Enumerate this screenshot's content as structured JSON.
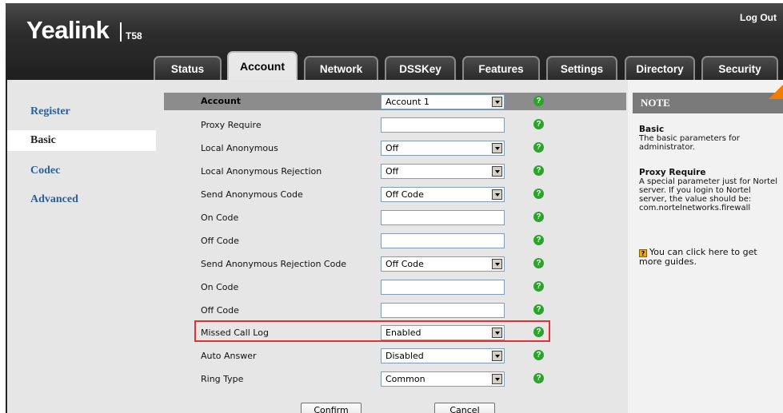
{
  "header": {
    "logo": "Yealink",
    "model": "T58",
    "logout": "Log Out"
  },
  "tabs": [
    {
      "label": "Status"
    },
    {
      "label": "Account",
      "active": true
    },
    {
      "label": "Network"
    },
    {
      "label": "DSSKey"
    },
    {
      "label": "Features"
    },
    {
      "label": "Settings"
    },
    {
      "label": "Directory"
    },
    {
      "label": "Security"
    }
  ],
  "leftnav": [
    {
      "label": "Register"
    },
    {
      "label": "Basic",
      "active": true
    },
    {
      "label": "Codec"
    },
    {
      "label": "Advanced"
    }
  ],
  "form": {
    "header_label": "Account",
    "header_value": "Account 1",
    "rows": [
      {
        "label": "Proxy Require",
        "type": "input",
        "value": ""
      },
      {
        "label": "Local Anonymous",
        "type": "select",
        "value": "Off"
      },
      {
        "label": "Local Anonymous Rejection",
        "type": "select",
        "value": "Off"
      },
      {
        "label": "Send Anonymous Code",
        "type": "select",
        "value": "Off Code"
      },
      {
        "label": "On Code",
        "type": "input",
        "value": ""
      },
      {
        "label": "Off Code",
        "type": "input",
        "value": ""
      },
      {
        "label": "Send Anonymous Rejection Code",
        "type": "select",
        "value": "Off Code"
      },
      {
        "label": "On Code",
        "type": "input",
        "value": ""
      },
      {
        "label": "Off Code",
        "type": "input",
        "value": ""
      },
      {
        "label": "Missed Call Log",
        "type": "select",
        "value": "Enabled",
        "highlighted": true
      },
      {
        "label": "Auto Answer",
        "type": "select",
        "value": "Disabled"
      },
      {
        "label": "Ring Type",
        "type": "select",
        "value": "Common"
      }
    ],
    "confirm_label": "Confirm",
    "cancel_label": "Cancel"
  },
  "help_glyph": "?",
  "note": {
    "title": "NOTE",
    "basic_title": "Basic",
    "basic_text": "The basic parameters for administrator.",
    "proxy_title": "Proxy Require",
    "proxy_text": "A special parameter just for Nortel server. If you login to Nortel server, the value should be: com.nortelnetworks.firewall",
    "guide_icon_glyph": "?",
    "guide_text": "You can click here to get more guides."
  },
  "colors": {
    "highlight_border": "#e53030",
    "help_icon": "#2aa52a",
    "nav_link": "#2a5f9a",
    "note_corner": "#f07f00"
  }
}
